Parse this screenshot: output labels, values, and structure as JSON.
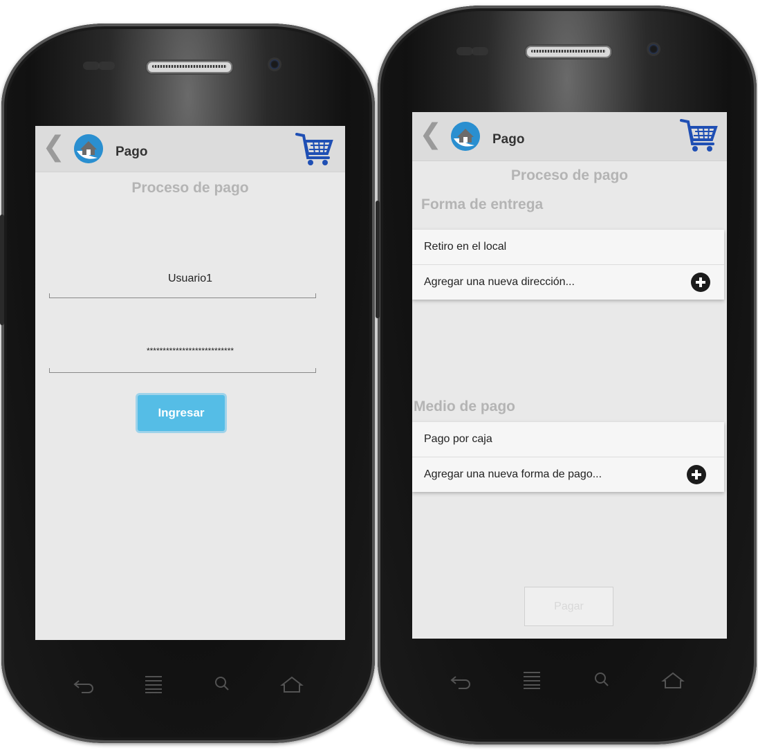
{
  "left_screen": {
    "header": {
      "title": "Pago"
    },
    "heading": "Proceso de pago",
    "username": {
      "value": "Usuario1"
    },
    "password": {
      "value": "***************************"
    },
    "submit_label": "Ingresar"
  },
  "right_screen": {
    "header": {
      "title": "Pago"
    },
    "heading": "Proceso de pago",
    "delivery": {
      "title": "Forma de entrega",
      "items": [
        {
          "label": "Retiro en el local"
        },
        {
          "label": "Agregar una nueva dirección..."
        }
      ]
    },
    "payment": {
      "title": "Medio de pago",
      "items": [
        {
          "label": "Pago por caja"
        },
        {
          "label": "Agregar una nueva forma de pago..."
        }
      ]
    },
    "pay_label": "Pagar"
  },
  "icons": {
    "back": "chevron-left-icon",
    "logo": "house-logo-icon",
    "cart": "shopping-cart-icon",
    "add": "plus-circle-icon",
    "nav": [
      "back-arrow-icon",
      "menu-icon",
      "search-icon",
      "home-icon"
    ]
  },
  "colors": {
    "accent": "#55bde6",
    "cart": "#1f4fb4",
    "screen_bg": "#e9e9e9",
    "header_bg": "#dcdcdc",
    "heading_text": "#b4b4b4"
  }
}
